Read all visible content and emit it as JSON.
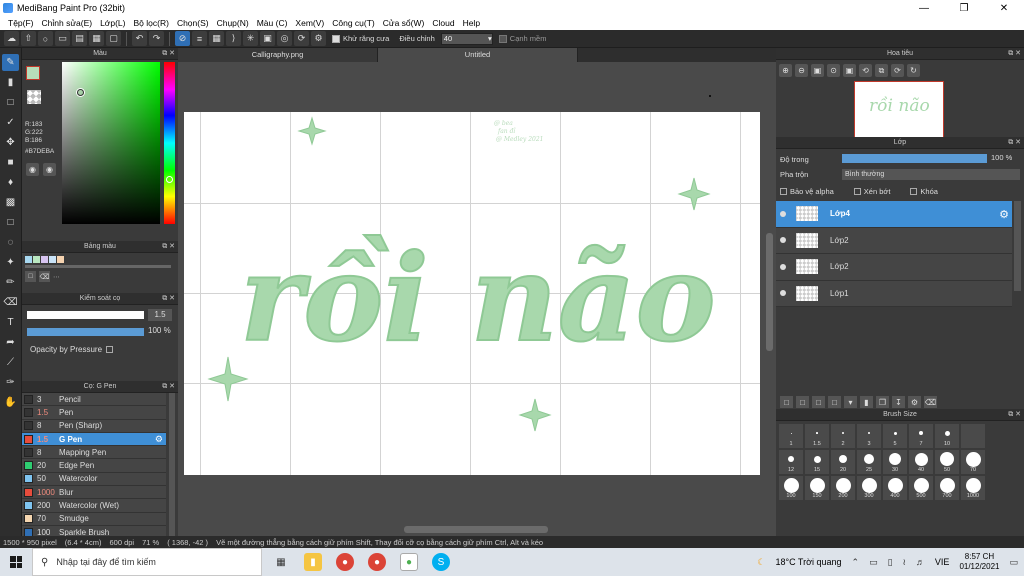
{
  "window": {
    "title": "MediBang Paint Pro (32bit)"
  },
  "menu": [
    "Tệp(F)",
    "Chỉnh sửa(E)",
    "Lớp(L)",
    "Bộ lọc(R)",
    "Chọn(S)",
    "Chụp(N)",
    "Màu (C)",
    "Xem(V)",
    "Công cụ(T)",
    "Cửa sổ(W)",
    "Cloud",
    "Help"
  ],
  "toolbar": {
    "antialias_label": "Khử răng cưa",
    "adjust_label": "Điều chỉnh",
    "adjust_value": "40",
    "smooth_label": "Cạnh mềm"
  },
  "panels": {
    "color": "Màu",
    "palette": "Bảng màu",
    "brush_control": "Kiểm soát cọ",
    "brush_list": "Cọ: G Pen",
    "navigator": "Hoa tiêu",
    "layer": "Lớp",
    "brush_size": "Brush Size"
  },
  "color": {
    "r": "R:183",
    "g": "G:222",
    "b": "B:186",
    "hex": "#B7DEBA",
    "current": "#b7deba"
  },
  "brush_control": {
    "size_value": "1.5",
    "opacity_value": "100 %",
    "opacity_pressure_label": "Opacity by Pressure"
  },
  "brushes": [
    {
      "size": "3",
      "name": "Pencil",
      "color": "#333333"
    },
    {
      "size": "1.5",
      "name": "Pen",
      "color": "#333333"
    },
    {
      "size": "8",
      "name": "Pen (Sharp)",
      "color": "#333333"
    },
    {
      "size": "1.5",
      "name": "G Pen",
      "color": "#e74c3c",
      "selected": true
    },
    {
      "size": "8",
      "name": "Mapping Pen",
      "color": "#333333"
    },
    {
      "size": "20",
      "name": "Edge Pen",
      "color": "#2ecc71"
    },
    {
      "size": "50",
      "name": "Watercolor",
      "color": "#7fc4f0"
    },
    {
      "size": "1000",
      "name": "Blur",
      "color": "#e74c3c"
    },
    {
      "size": "200",
      "name": "Watercolor (Wet)",
      "color": "#7fc4f0"
    },
    {
      "size": "70",
      "name": "Smudge",
      "color": "#f5d6b0"
    },
    {
      "size": "100",
      "name": "Sparkle Brush",
      "color": "#2f6fb5"
    }
  ],
  "tabs": [
    {
      "label": "Calligraphy.png"
    },
    {
      "label": "Untitled",
      "active": true
    }
  ],
  "canvas": {
    "text": "rồi não",
    "ink_color": "#a8d8ac",
    "watermark_lines": [
      "@ bea",
      "fan đỉ",
      "@ Medley 2021"
    ]
  },
  "layer": {
    "opacity_label": "Độ trong",
    "opacity_value": "100 %",
    "blend_label": "Pha trộn",
    "blend_value": "Bình thường",
    "protect_alpha": "Bảo vệ alpha",
    "clipping": "Xén bớt",
    "lock": "Khóa",
    "layers": [
      {
        "name": "Lớp4",
        "selected": true
      },
      {
        "name": "Lớp2"
      },
      {
        "name": "Lớp2"
      },
      {
        "name": "Lớp1"
      }
    ]
  },
  "brush_sizes": [
    {
      "label": "1",
      "d": 1
    },
    {
      "label": "1.5",
      "d": 1.5
    },
    {
      "label": "2",
      "d": 2
    },
    {
      "label": "3",
      "d": 2.5
    },
    {
      "label": "5",
      "d": 3
    },
    {
      "label": "7",
      "d": 4
    },
    {
      "label": "10",
      "d": 5
    },
    {
      "label": "",
      "d": 0
    },
    {
      "label": "12",
      "d": 6
    },
    {
      "label": "15",
      "d": 7
    },
    {
      "label": "20",
      "d": 8
    },
    {
      "label": "25",
      "d": 10
    },
    {
      "label": "30",
      "d": 12
    },
    {
      "label": "40",
      "d": 13
    },
    {
      "label": "50",
      "d": 14
    },
    {
      "label": "70",
      "d": 15
    },
    {
      "label": "100",
      "d": 15
    },
    {
      "label": "150",
      "d": 15
    },
    {
      "label": "200",
      "d": 15
    },
    {
      "label": "300",
      "d": 15
    },
    {
      "label": "400",
      "d": 15
    },
    {
      "label": "500",
      "d": 15
    },
    {
      "label": "700",
      "d": 15
    },
    {
      "label": "1000",
      "d": 15
    }
  ],
  "status": {
    "size": "1500 * 950 pixel",
    "cm": "(6.4 * 4cm)",
    "dpi": "600 dpi",
    "zoom": "71 %",
    "coords": "( 1368, -42 )",
    "hint": "Vẽ một đường thẳng bằng cách giữ phím Shift, Thay đổi cỡ cọ bằng cách giữ phím Ctrl, Alt và kéo"
  },
  "taskbar": {
    "search_placeholder": "Nhập tại đây để tìm kiếm",
    "weather": "18°C Trời quang",
    "lang": "VIE",
    "time": "8:57 CH",
    "date": "01/12/2021"
  }
}
